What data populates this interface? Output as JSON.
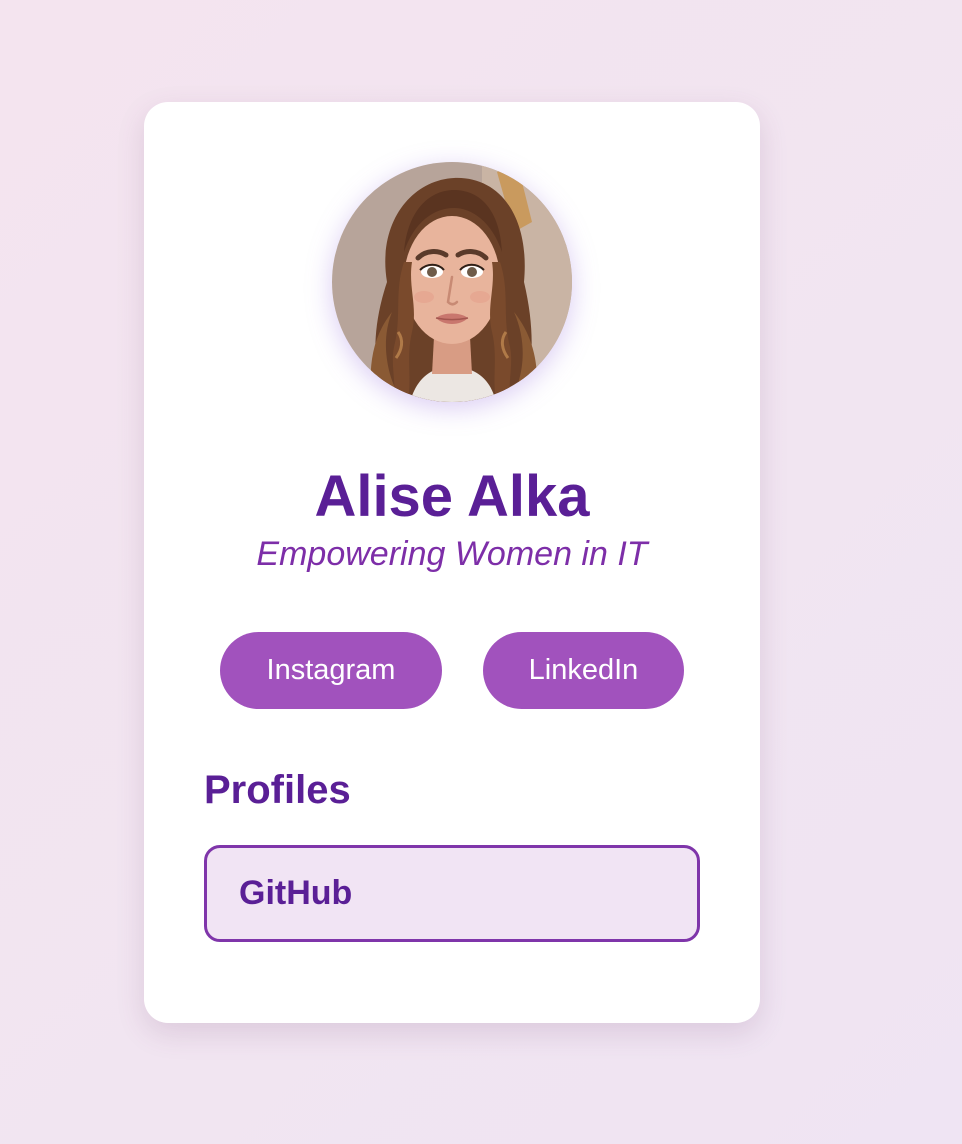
{
  "profile": {
    "name": "Alise Alka",
    "tagline": "Empowering Women in IT"
  },
  "social_links": [
    {
      "label": "Instagram"
    },
    {
      "label": "LinkedIn"
    }
  ],
  "profiles_section": {
    "title": "Profiles",
    "items": [
      {
        "label": "GitHub"
      }
    ]
  },
  "colors": {
    "background": "#f3e4f0",
    "card": "#ffffff",
    "heading": "#5a1f96",
    "tagline": "#7d2ea8",
    "button": "#a152bd",
    "profile_border": "#7f35aa",
    "profile_fill": "#f1e4f4"
  }
}
